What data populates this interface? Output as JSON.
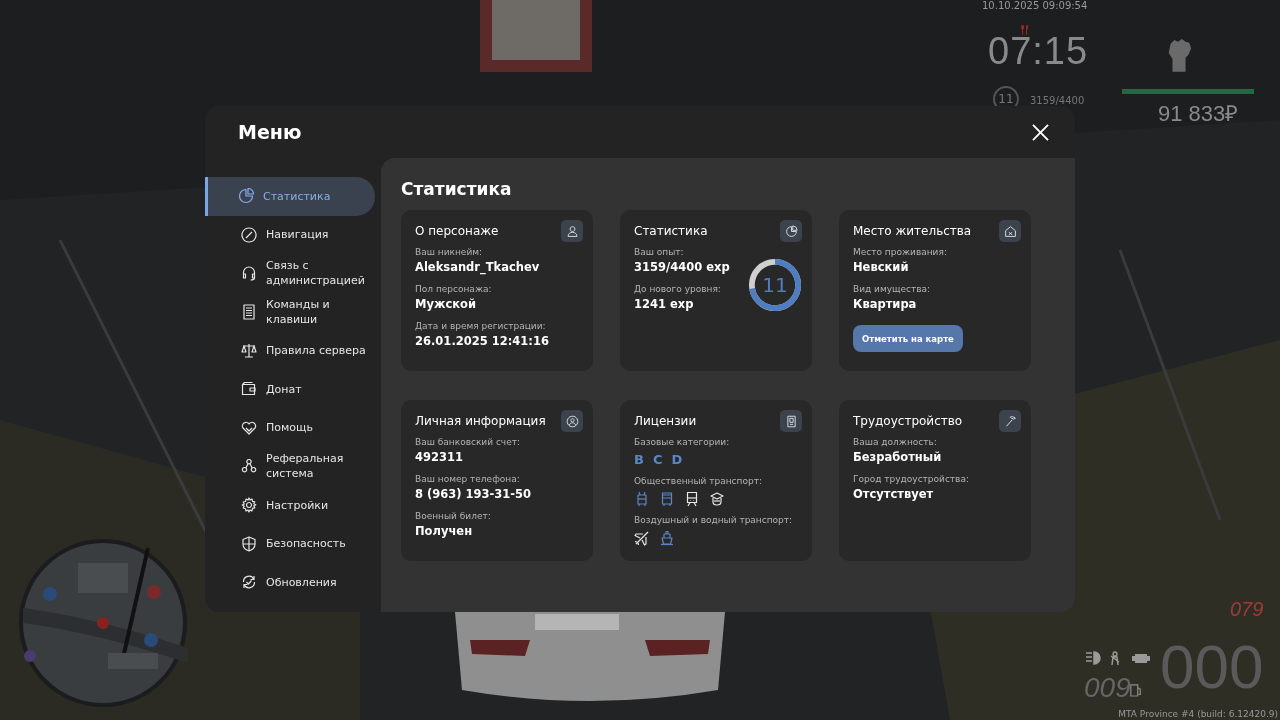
{
  "hud": {
    "datetime": "10.10.2025 09:09:54",
    "clock": "07:15",
    "level": "11",
    "experience": "3159/4400",
    "health": {
      "level": 1
    },
    "money": "91 833₽",
    "speed_limit": "079",
    "fuel": "009",
    "speed": "000",
    "server_build": "MTA Province #4 (build: 6.12420.9)"
  },
  "menu": {
    "title": "Меню"
  },
  "sidebar": {
    "items": [
      {
        "label": "Статистика",
        "selected": true
      },
      {
        "label": "Навигация",
        "selected": false
      },
      {
        "label": "Связь с администрацией",
        "selected": false
      },
      {
        "label": "Команды и клавиши",
        "selected": false
      },
      {
        "label": "Правила сервера",
        "selected": false
      },
      {
        "label": "Донат",
        "selected": false
      },
      {
        "label": "Помощь",
        "selected": false
      },
      {
        "label": "Реферальная система",
        "selected": false
      },
      {
        "label": "Настройки",
        "selected": false
      },
      {
        "label": "Безопасность",
        "selected": false
      },
      {
        "label": "Обновления",
        "selected": false
      }
    ]
  },
  "content": {
    "title": "Статистика",
    "cards": [
      {
        "kind": "fields",
        "title": "О персонаже",
        "fields": [
          {
            "label": "Ваш никнейм:",
            "value": "Aleksandr_Tkachev"
          },
          {
            "label": "Пол персонажа:",
            "value": "Мужской"
          },
          {
            "label": "Дата и время регистрации:",
            "value": "26.01.2025 12:41:16"
          }
        ]
      },
      {
        "kind": "progress",
        "title": "Статистика",
        "fields": [
          {
            "label": "Ваш опыт:",
            "value": "3159/4400 exp"
          },
          {
            "label": "До нового уровня:",
            "value": "1241 exp"
          }
        ],
        "ring": {
          "value": "11",
          "level": 0.72
        }
      },
      {
        "kind": "fields",
        "title": "Место жительства",
        "fields": [
          {
            "label": "Место проживания:",
            "value": "Невский"
          },
          {
            "label": "Вид имущества:",
            "value": "Квартира"
          }
        ],
        "button": "Отметить на карте"
      },
      {
        "kind": "fields",
        "title": "Личная информация",
        "fields": [
          {
            "label": "Ваш банковский счет:",
            "value": "492311"
          },
          {
            "label": "Ваш номер телефона:",
            "value": "8 (963) 193-31-50"
          },
          {
            "label": "Военный билет:",
            "value": "Получен"
          }
        ]
      },
      {
        "kind": "licenses",
        "title": "Лицензии",
        "groups": [
          {
            "label": "Базовые категории:",
            "kind": "letters",
            "items": [
              {
                "text": "B",
                "held": true
              },
              {
                "text": "C",
                "held": true
              },
              {
                "text": "D",
                "held": true
              }
            ]
          },
          {
            "label": "Общественный транспорт:",
            "kind": "icons",
            "items": [
              {
                "held": true
              },
              {
                "held": true
              },
              {
                "held": false
              },
              {
                "held": false
              }
            ]
          },
          {
            "label": "Воздушный и водный транспорт:",
            "kind": "icons",
            "items": [
              {
                "held": false
              },
              {
                "held": true
              }
            ]
          }
        ]
      },
      {
        "kind": "fields",
        "title": "Трудоустройство",
        "fields": [
          {
            "label": "Ваша должность:",
            "value": "Безработный"
          },
          {
            "label": "Город трудоустройства:",
            "value": "Отсутствует"
          }
        ]
      }
    ]
  }
}
